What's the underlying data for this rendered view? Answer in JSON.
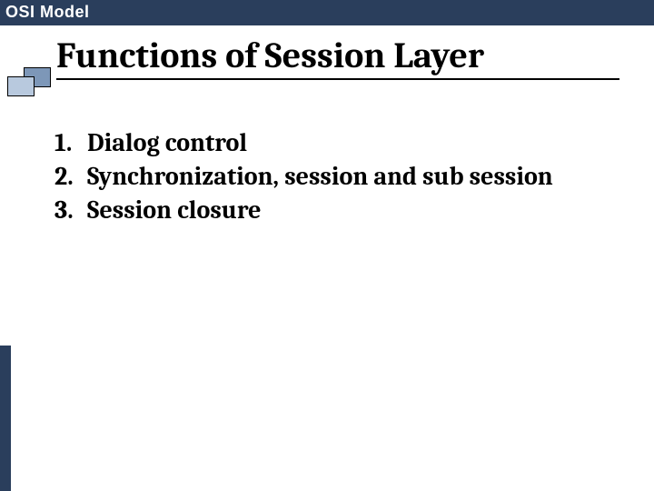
{
  "header": {
    "title": "OSI Model"
  },
  "slide": {
    "heading": "Functions of Session Layer",
    "items": [
      "Dialog control",
      "Synchronization, session and sub session",
      "Session closure"
    ]
  }
}
